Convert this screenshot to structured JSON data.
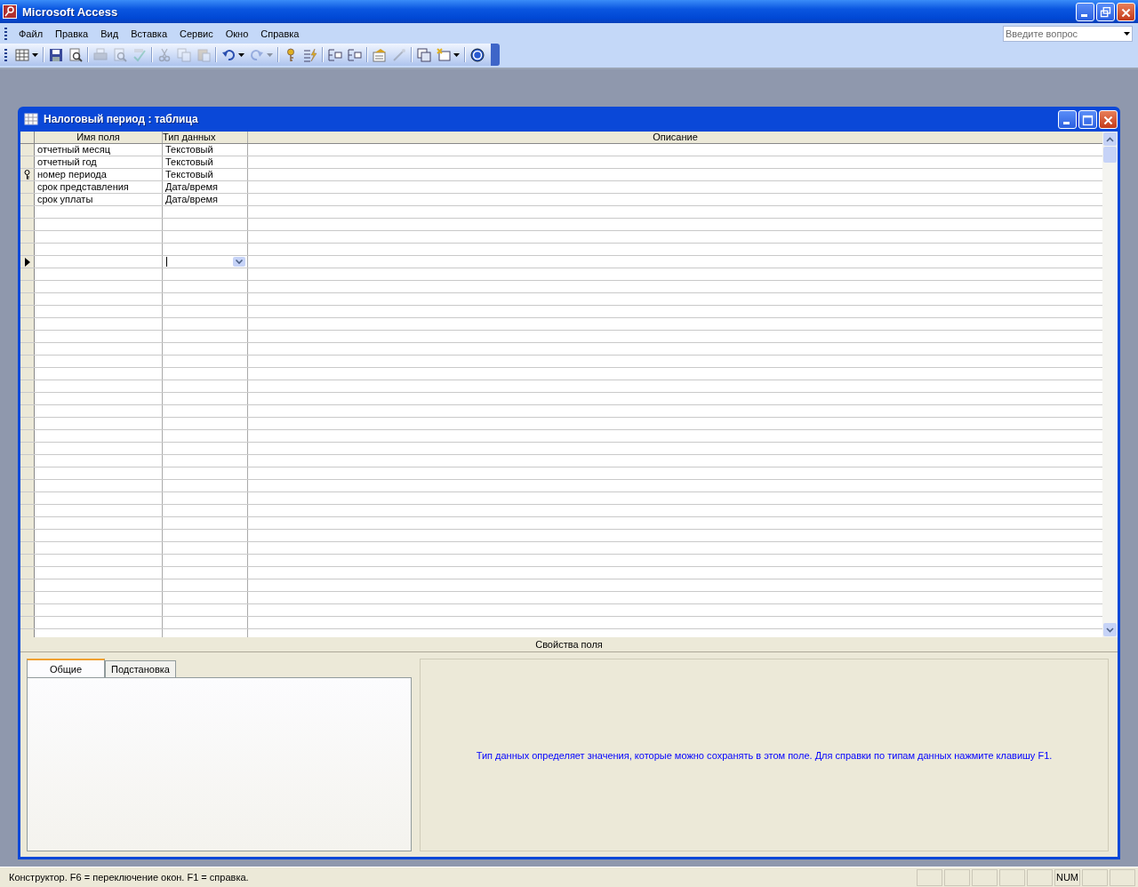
{
  "app_window": {
    "title": "Microsoft Access"
  },
  "menu": [
    {
      "label": "Файл"
    },
    {
      "label": "Правка"
    },
    {
      "label": "Вид"
    },
    {
      "label": "Вставка"
    },
    {
      "label": "Сервис"
    },
    {
      "label": "Окно"
    },
    {
      "label": "Справка"
    }
  ],
  "question_box": {
    "placeholder": "Введите вопрос"
  },
  "toolbar": [
    {
      "disabled": false
    },
    {
      "disabled": false
    },
    {
      "disabled": false
    },
    {
      "disabled": true
    },
    {
      "disabled": true
    },
    {
      "disabled": true
    },
    {
      "disabled": true
    },
    {
      "disabled": true
    },
    {
      "disabled": true
    },
    {
      "disabled": false
    },
    {
      "disabled": true
    },
    {
      "disabled": false
    },
    {
      "disabled": false
    },
    {
      "disabled": false
    },
    {
      "disabled": false
    },
    {
      "disabled": false
    },
    {
      "disabled": true
    },
    {
      "disabled": false
    },
    {
      "disabled": false
    },
    {
      "disabled": false
    }
  ],
  "table_window": {
    "title": "Налоговый период : таблица",
    "columns": [
      "Имя поля",
      "Тип данных",
      "Описание"
    ],
    "rows": [
      {
        "name": "отчетный месяц",
        "type": "Текстовый",
        "primary_key": false,
        "current": false
      },
      {
        "name": "отчетный год",
        "type": "Текстовый",
        "primary_key": false,
        "current": false
      },
      {
        "name": "номер периода",
        "type": "Текстовый",
        "primary_key": true,
        "current": false
      },
      {
        "name": "срок представления",
        "type": "Дата/время",
        "primary_key": false,
        "current": false
      },
      {
        "name": "срок уплаты",
        "type": "Дата/время",
        "primary_key": false,
        "current": false
      }
    ],
    "edit_row": {
      "current": true
    },
    "properties_title": "Свойства поля",
    "tabs": [
      {
        "label": "Общие",
        "selected": true
      },
      {
        "label": "Подстановка",
        "selected": false
      }
    ],
    "help_text": "Тип данных определяет значения, которые можно сохранять в этом поле.  Для справки по типам данных нажмите клавишу F1."
  },
  "status_bar": {
    "text": "Конструктор.  F6 = переключение окон.  F1 = справка.",
    "indicator": "NUM"
  }
}
